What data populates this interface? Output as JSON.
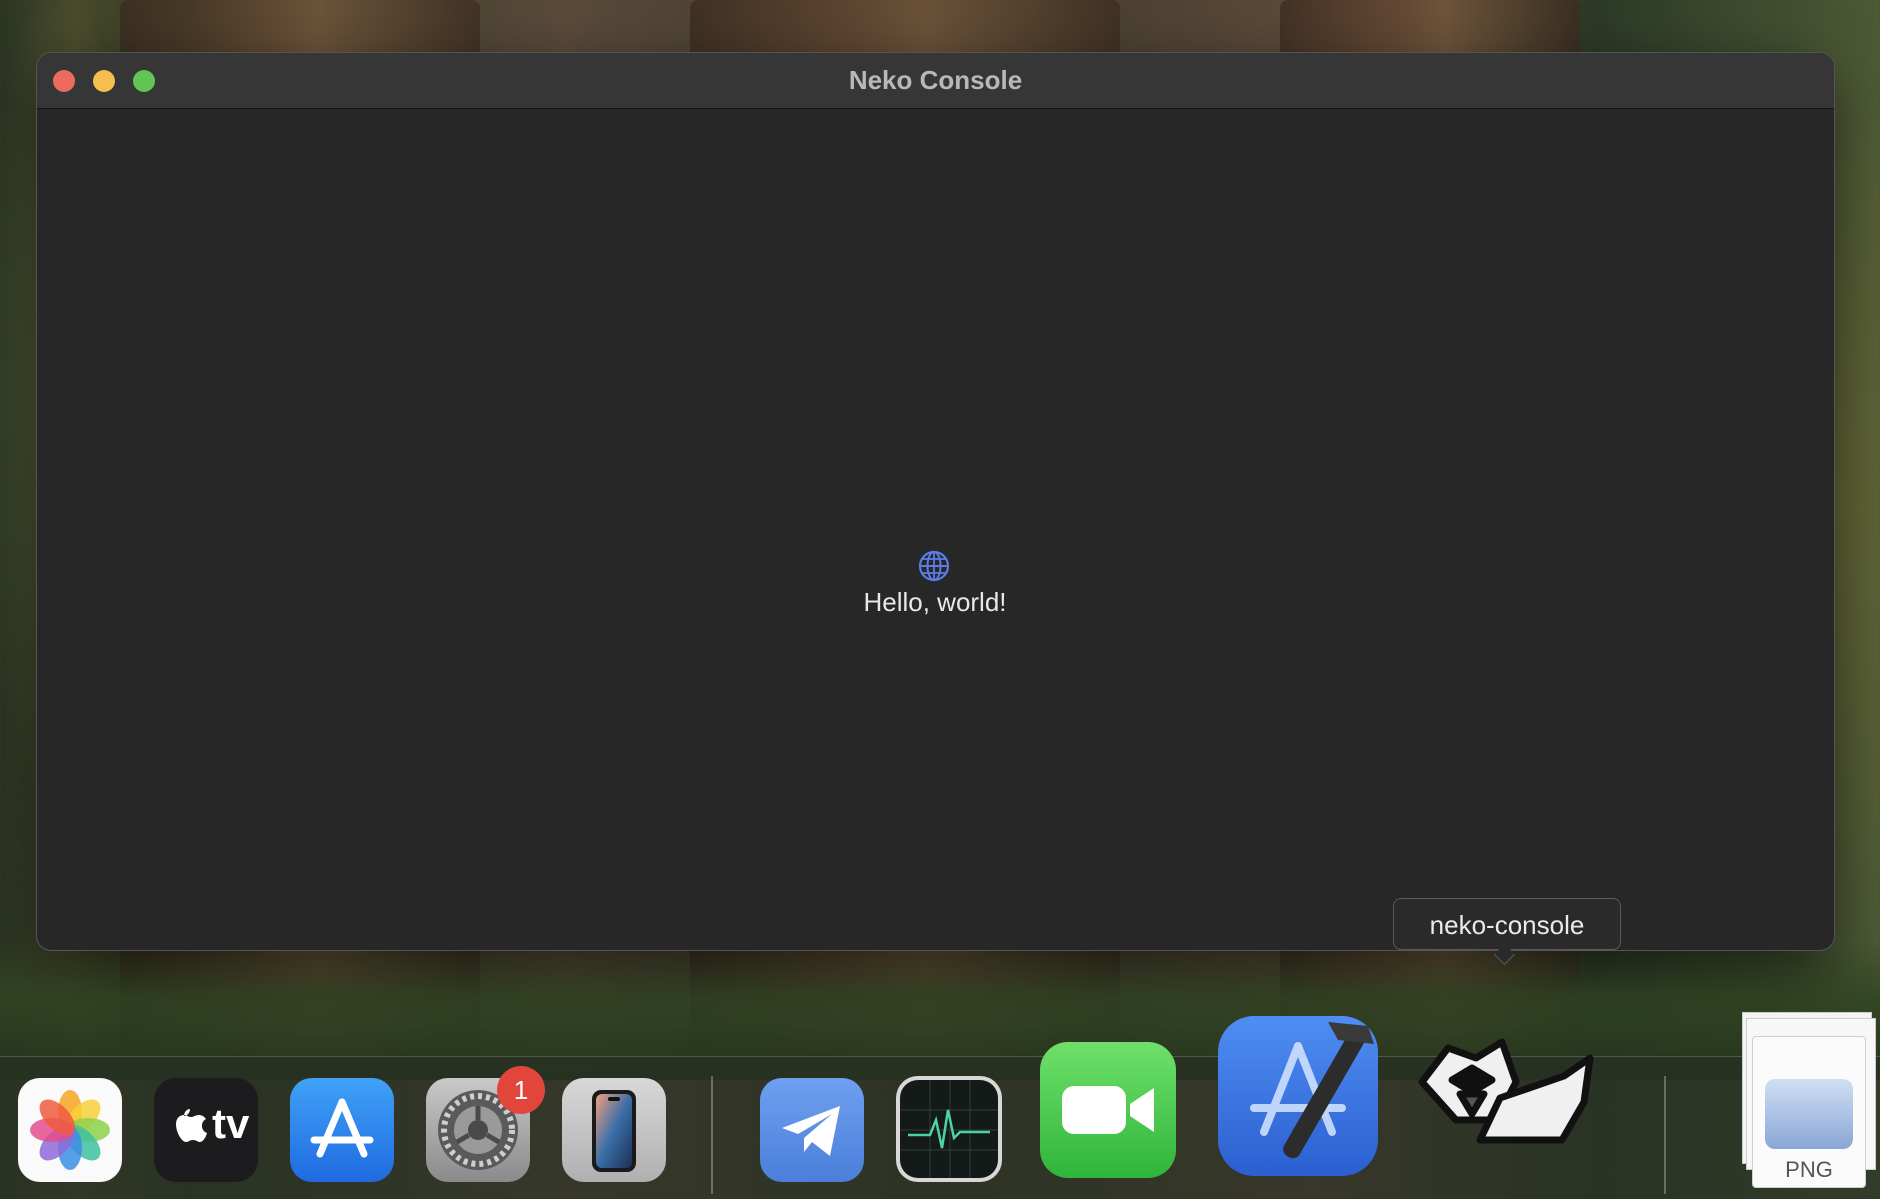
{
  "window": {
    "title": "Neko Console",
    "content_text": "Hello, world!"
  },
  "tooltip": {
    "text": "neko-console"
  },
  "dock": {
    "apps": [
      {
        "name": "Photos",
        "icon": "photos-icon"
      },
      {
        "name": "Apple TV",
        "icon": "apple-tv-icon",
        "label": "tv"
      },
      {
        "name": "App Store",
        "icon": "app-store-icon"
      },
      {
        "name": "System Settings",
        "icon": "gear-icon",
        "badge": "1"
      },
      {
        "name": "iPhone Mirroring",
        "icon": "iphone-icon"
      },
      {
        "name": "Telegram",
        "icon": "telegram-icon"
      },
      {
        "name": "Activity Monitor",
        "icon": "activity-monitor-icon"
      },
      {
        "name": "FaceTime",
        "icon": "facetime-icon"
      },
      {
        "name": "Xcode",
        "icon": "xcode-icon"
      },
      {
        "name": "neko-console",
        "icon": "neko-cat-icon"
      }
    ],
    "file": {
      "label": "PNG",
      "icon": "png-file-icon"
    },
    "colors": {
      "badge": "#e2463b",
      "accent": "#5b7be8"
    }
  }
}
